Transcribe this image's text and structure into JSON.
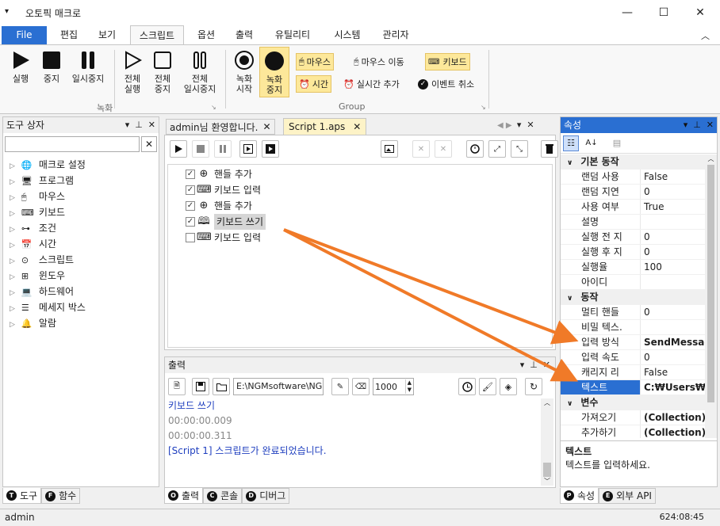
{
  "window": {
    "title": "오토픽 매크로",
    "menu_icon": "chevron-down-icon"
  },
  "menu": {
    "file": "File",
    "tabs": [
      "편집",
      "보기",
      "스크립트",
      "옵션",
      "출력",
      "유틸리티",
      "시스템",
      "관리자"
    ],
    "active": "스크립트"
  },
  "ribbon": {
    "record_buttons": [
      "실행",
      "중지",
      "일시중지",
      "전체\n실행",
      "전체\n중지",
      "전체\n일시중지"
    ],
    "record_group": "녹화",
    "rec_start": "녹화\n시작",
    "rec_stop": "녹화\n중지",
    "mouse": "마우스",
    "mouse_move": "마우스 이동",
    "keyboard": "키보드",
    "time": "시간",
    "realtime_add": "실시간 추가",
    "event_cancel": "이벤트 취소",
    "group2": "Group"
  },
  "toolbox": {
    "title": "도구 상자",
    "search_value": "",
    "items": [
      "매크로 설정",
      "프로그램",
      "마우스",
      "키보드",
      "조건",
      "시간",
      "스크립트",
      "윈도우",
      "하드웨어",
      "메세지 박스",
      "알람"
    ],
    "tabs": [
      {
        "badge": "T",
        "label": "도구"
      },
      {
        "badge": "F",
        "label": "함수"
      }
    ]
  },
  "editor": {
    "tabs": [
      "admin님 환영합니다.",
      "Script 1.aps"
    ],
    "lines": [
      {
        "checked": true,
        "icon": "crosshair-icon",
        "text": "핸들 추가"
      },
      {
        "checked": true,
        "icon": "keyboard-icon",
        "text": "키보드 입력"
      },
      {
        "checked": true,
        "icon": "crosshair-icon",
        "text": "핸들 추가"
      },
      {
        "checked": true,
        "icon": "book-icon",
        "text": "키보드 쓰기"
      },
      {
        "checked": false,
        "icon": "keyboard-icon",
        "text": "키보드 입력"
      }
    ]
  },
  "output": {
    "title": "출력",
    "path": "E:\\NGMsoftware\\NG",
    "interval": "1000",
    "lines": [
      "키보드 쓰기",
      "00:00:00.009",
      "00:00:00.311",
      "[Script 1] 스크립트가 완료되었습니다."
    ],
    "tabs": [
      {
        "badge": "O",
        "label": "출력"
      },
      {
        "badge": "C",
        "label": "콘솔"
      },
      {
        "badge": "D",
        "label": "디버그"
      }
    ]
  },
  "properties": {
    "title": "속성",
    "categories": [
      {
        "name": "기본 동작",
        "rows": [
          [
            "랜덤 사용",
            "False"
          ],
          [
            "랜덤 지연",
            "0"
          ],
          [
            "사용 여부",
            "True"
          ],
          [
            "설명",
            ""
          ],
          [
            "실행 전 지",
            "0"
          ],
          [
            "실행 후 지",
            "0"
          ],
          [
            "실행율",
            "100"
          ],
          [
            "아이디",
            ""
          ]
        ]
      },
      {
        "name": "동작",
        "rows": [
          [
            "멀티 핸들",
            "0"
          ],
          [
            "비밀 텍스.",
            ""
          ],
          [
            "입력 방식",
            "SendMessage"
          ],
          [
            "입력 속도",
            "0"
          ],
          [
            "캐리지 리",
            "False"
          ],
          [
            "텍스트",
            "C:₩Users₩ng"
          ]
        ]
      },
      {
        "name": "변수",
        "rows": [
          [
            "가져오기",
            "(Collection)"
          ],
          [
            "추가하기",
            "(Collection)"
          ]
        ]
      }
    ],
    "help_title": "텍스트",
    "help_text": "텍스트를 입력하세요.",
    "tabs": [
      {
        "badge": "P",
        "label": "속성"
      },
      {
        "badge": "E",
        "label": "외부 API"
      }
    ]
  },
  "status": {
    "user": "admin",
    "time": "624:08:45"
  },
  "colors": {
    "accent": "#2a6fd2",
    "arrow": "#f07a28",
    "highlight": "#fde89a"
  }
}
